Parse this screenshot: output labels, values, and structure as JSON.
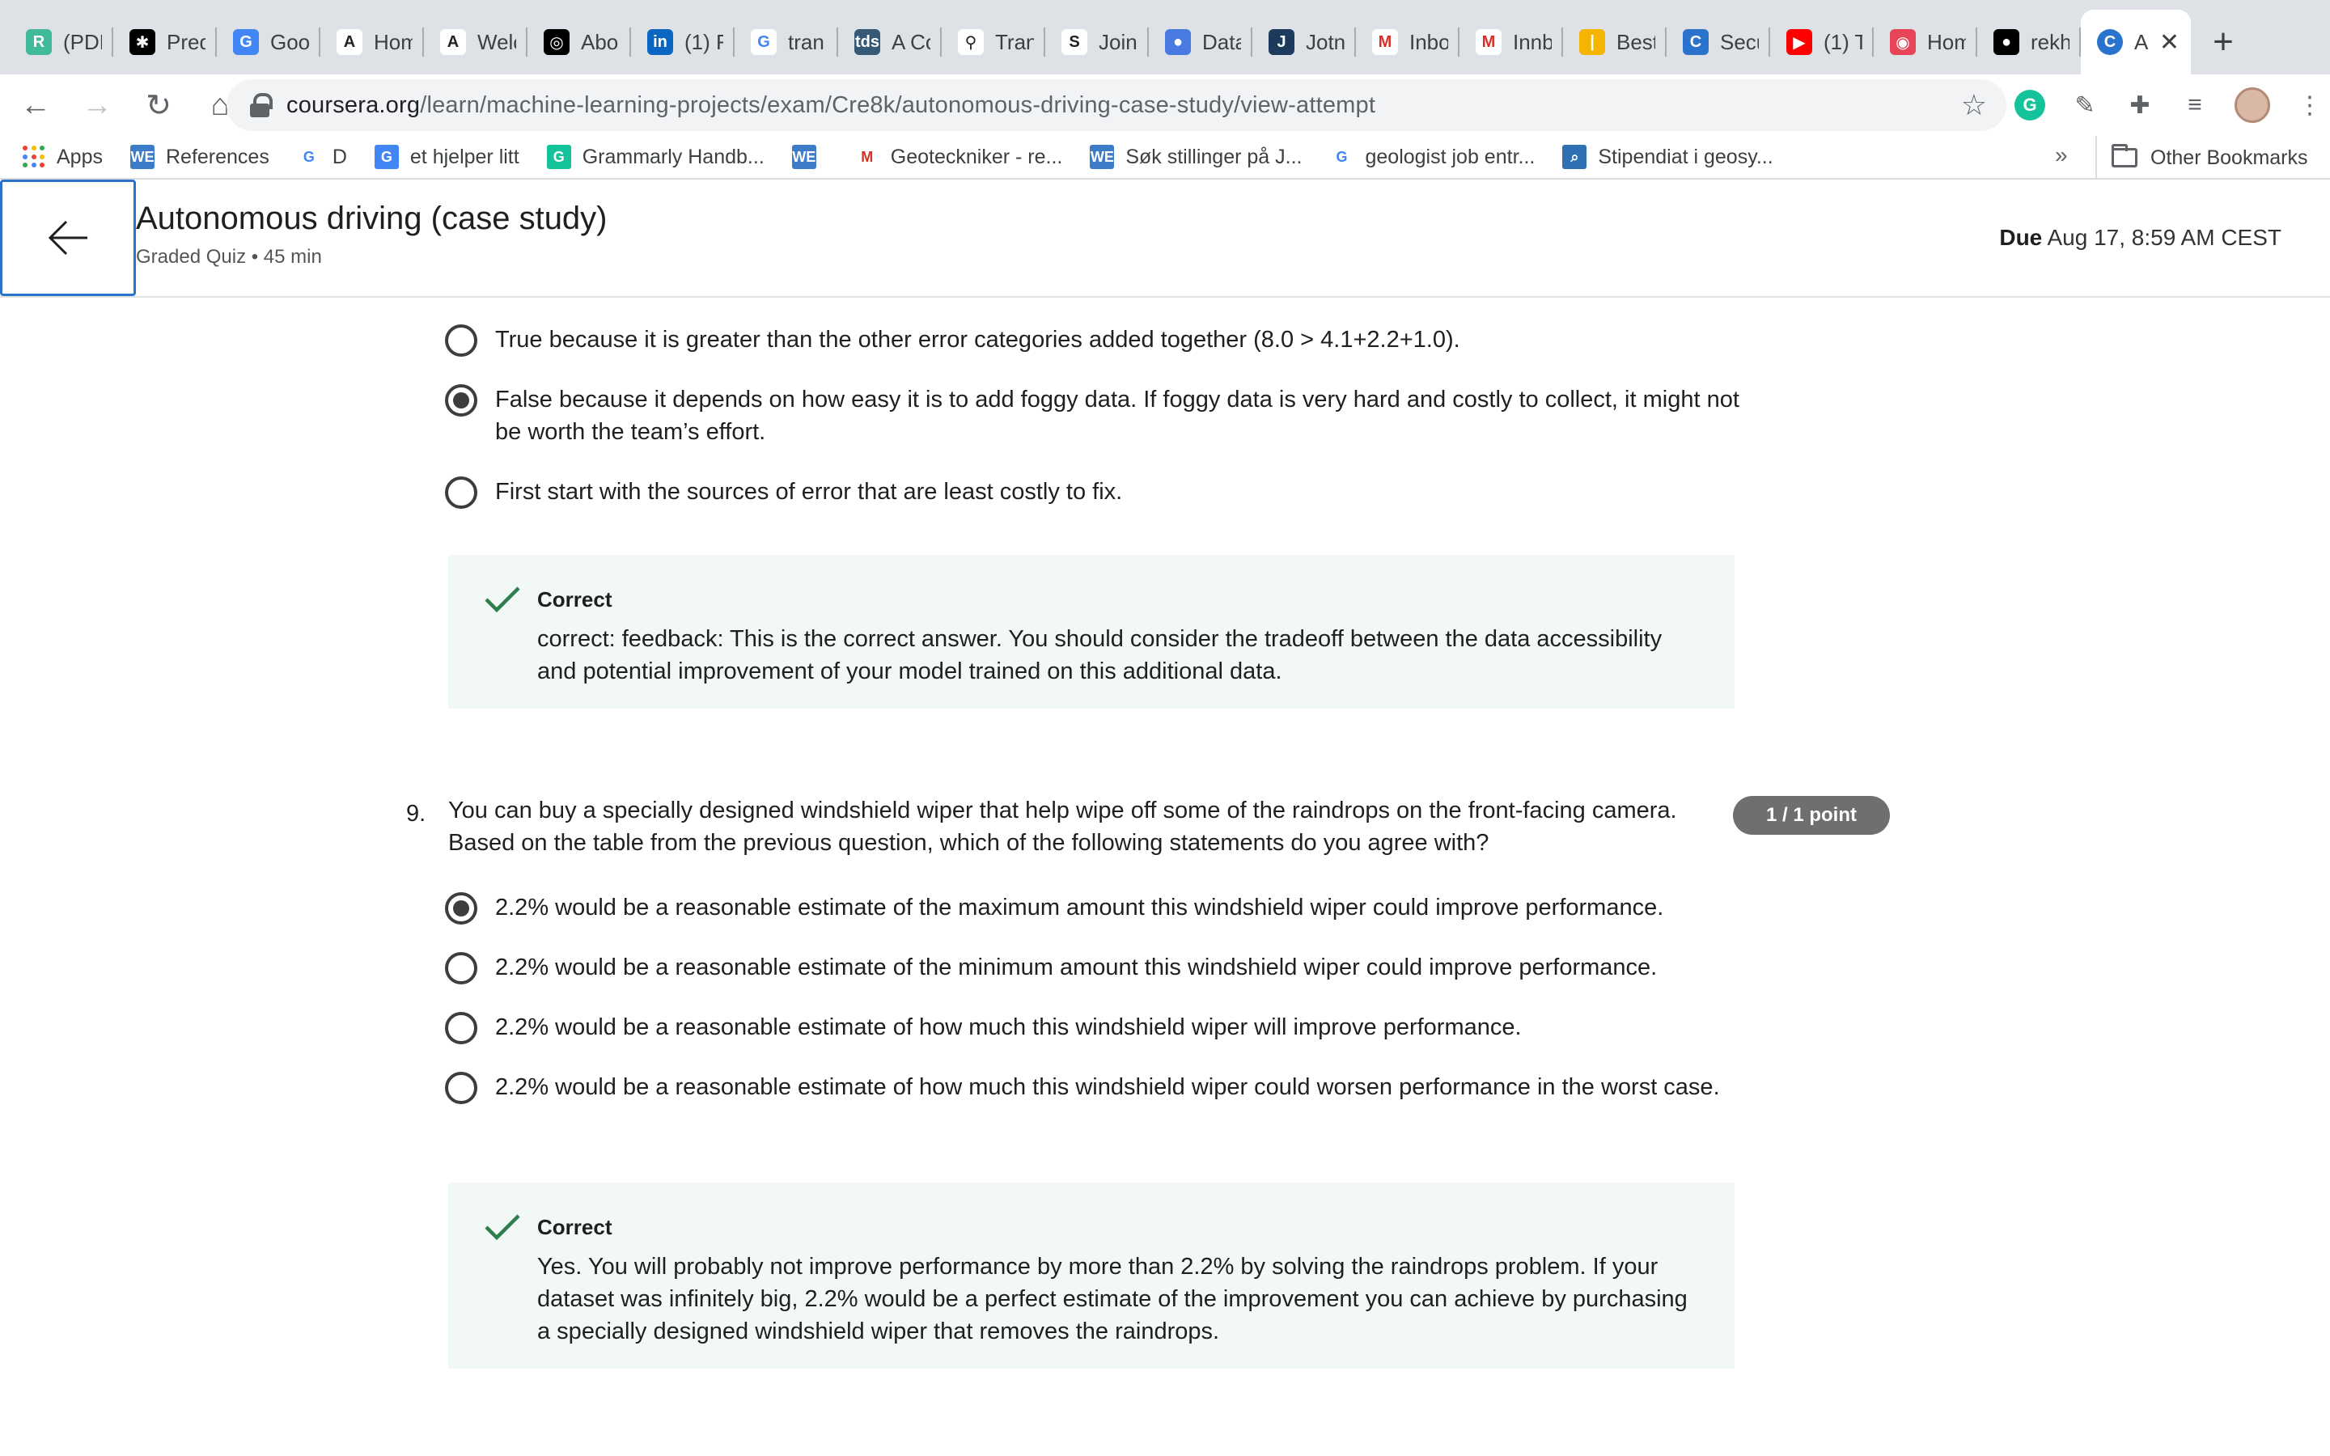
{
  "browser": {
    "tabs": [
      {
        "label": "(PDF",
        "icon": "researchgate-icon",
        "color": "#40ba9b"
      },
      {
        "label": "Pred",
        "icon": "gear-logo-icon",
        "color": "#000000"
      },
      {
        "label": "Goo",
        "icon": "google-translate-icon",
        "color": "#4285f4"
      },
      {
        "label": "Hom",
        "icon": "letter-a-icon",
        "color": "#ffffff"
      },
      {
        "label": "Welc",
        "icon": "letter-a-icon",
        "color": "#ffffff"
      },
      {
        "label": "Abo",
        "icon": "openai-icon",
        "color": "#000000"
      },
      {
        "label": "(1) F",
        "icon": "linkedin-icon",
        "color": "#0a66c2"
      },
      {
        "label": "tran",
        "icon": "google-icon",
        "color": "#ffffff"
      },
      {
        "label": "A Co",
        "icon": "tds-icon",
        "color": "#355876"
      },
      {
        "label": "Tran",
        "icon": "bike-icon",
        "color": "#ffffff"
      },
      {
        "label": "Join",
        "icon": "slack-s-icon",
        "color": "#ffffff"
      },
      {
        "label": "Data",
        "icon": "drop-icon",
        "color": "#4a7be0"
      },
      {
        "label": "Jotn",
        "icon": "letter-j-icon",
        "color": "#1b3a5c"
      },
      {
        "label": "Inbo",
        "icon": "gmail-icon",
        "color": "#ffffff"
      },
      {
        "label": "Innb",
        "icon": "gmail-icon",
        "color": "#ffffff"
      },
      {
        "label": "Best",
        "icon": "bar-icon",
        "color": "#f4b400"
      },
      {
        "label": "Secu",
        "icon": "coursera-icon",
        "color": "#2a73cc"
      },
      {
        "label": "(1) T",
        "icon": "youtube-icon",
        "color": "#ff0000"
      },
      {
        "label": "Hom",
        "icon": "target-icon",
        "color": "#e8455b"
      },
      {
        "label": "rekh",
        "icon": "github-icon",
        "color": "#000000"
      }
    ],
    "active_tab": {
      "label": "A",
      "icon": "coursera-icon",
      "color": "#2a73cc",
      "close": "✕"
    },
    "new_tab": "+",
    "url_host": "coursera.org",
    "url_path": "/learn/machine-learning-projects/exam/Cre8k/autonomous-driving-case-study/view-attempt",
    "bookmarks": [
      {
        "label": "Apps",
        "icon": "apps-grid-icon"
      },
      {
        "label": "References",
        "icon": "we-icon",
        "color": "#3d7cc9"
      },
      {
        "label": "D",
        "icon": "google-icon"
      },
      {
        "label": "et hjelper litt",
        "icon": "google-translate-icon",
        "color": "#4285f4"
      },
      {
        "label": "Grammarly Handb...",
        "icon": "grammarly-icon",
        "color": "#15c39a"
      },
      {
        "label": "",
        "icon": "we-icon",
        "color": "#3d7cc9"
      },
      {
        "label": "Geoteckniker - re...",
        "icon": "gmail-icon"
      },
      {
        "label": "Søk stillinger på J...",
        "icon": "we-icon",
        "color": "#3d7cc9"
      },
      {
        "label": "geologist job entr...",
        "icon": "google-icon"
      },
      {
        "label": "Stipendiat i geosy...",
        "icon": "search-box-icon",
        "color": "#2f6fb3"
      }
    ],
    "bookmarks_more": "»",
    "other_bookmarks": "Other Bookmarks"
  },
  "header": {
    "title": "Autonomous driving (case study)",
    "subtitle": "Graded Quiz • 45 min",
    "due_label": "Due",
    "due_value": "Aug 17, 8:59 AM CEST"
  },
  "question8": {
    "options": [
      {
        "text": "True because it is greater than the other error categories added together (8.0 > 4.1+2.2+1.0).",
        "selected": false
      },
      {
        "text": "False because it depends on how easy it is to add foggy data. If foggy data is very hard and costly to collect, it might not be worth the team’s effort.",
        "selected": true
      },
      {
        "text": "First start with the sources of error that are least costly to fix.",
        "selected": false
      }
    ],
    "feedback_title": "Correct",
    "feedback_text": "correct: feedback: This is the correct answer. You should consider the tradeoff between the data accessibility and potential improvement of your model trained on this additional data."
  },
  "question9": {
    "number": "9.",
    "text": "You can buy a specially designed windshield wiper that help wipe off some of the raindrops on the front-facing camera. Based on the table from the previous question, which of the following statements do you agree with?",
    "points": "1 / 1 point",
    "options": [
      {
        "text": "2.2% would be a reasonable estimate of the maximum amount this windshield wiper could improve performance.",
        "selected": true
      },
      {
        "text": "2.2% would be a reasonable estimate of the minimum amount this windshield wiper could improve performance.",
        "selected": false
      },
      {
        "text": "2.2% would be a reasonable estimate of how much this windshield wiper will improve performance.",
        "selected": false
      },
      {
        "text": "2.2% would be a reasonable estimate of how much this windshield wiper could worsen performance in the worst case.",
        "selected": false
      }
    ],
    "feedback_title": "Correct",
    "feedback_text": "Yes. You will probably not improve performance by more than 2.2% by solving the raindrops problem. If your dataset was infinitely big, 2.2% would be a perfect estimate of the improvement you can achieve by purchasing a specially designed windshield wiper that removes the raindrops."
  },
  "colors": {
    "accent": "#2a73cc",
    "correct_green": "#2f7d4e",
    "feedback_bg": "#f2f8f5",
    "points_badge": "#6f6f6f"
  }
}
